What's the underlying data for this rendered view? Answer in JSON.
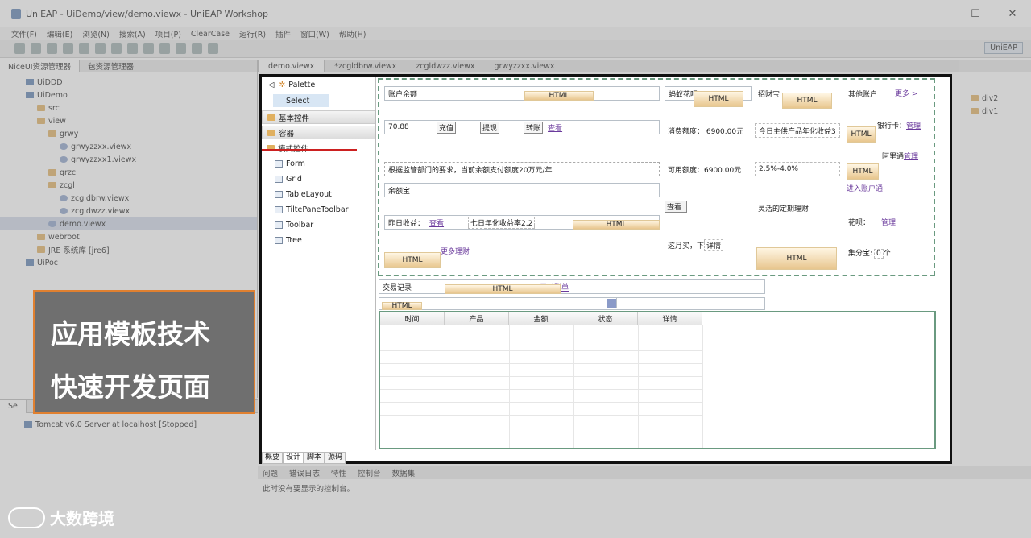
{
  "window": {
    "title": "UniEAP - UiDemo/view/demo.viewx - UniEAP Workshop",
    "controls": [
      "—",
      "☐",
      "✕"
    ]
  },
  "menu": [
    "文件(F)",
    "编辑(E)",
    "浏览(N)",
    "搜索(A)",
    "项目(P)",
    "ClearCase",
    "运行(R)",
    "插件",
    "窗口(W)",
    "帮助(H)"
  ],
  "perspective": {
    "label": "UniEAP"
  },
  "explorer": {
    "tabs": [
      "NiceUI资源管理器",
      "包资源管理器"
    ],
    "tree": [
      {
        "label": "UiDDD",
        "depth": 0,
        "type": "proj"
      },
      {
        "label": "UiDemo",
        "depth": 0,
        "type": "proj"
      },
      {
        "label": "src",
        "depth": 1,
        "type": "folder"
      },
      {
        "label": "view",
        "depth": 1,
        "type": "folder"
      },
      {
        "label": "grwy",
        "depth": 2,
        "type": "folder"
      },
      {
        "label": "grwyzzxx.viewx",
        "depth": 3,
        "type": "file"
      },
      {
        "label": "grwyzzxx1.viewx",
        "depth": 3,
        "type": "file"
      },
      {
        "label": "grzc",
        "depth": 2,
        "type": "folder"
      },
      {
        "label": "zcgl",
        "depth": 2,
        "type": "folder"
      },
      {
        "label": "zcgldbrw.viewx",
        "depth": 3,
        "type": "file"
      },
      {
        "label": "zcgldwzz.viewx",
        "depth": 3,
        "type": "file"
      },
      {
        "label": "demo.viewx",
        "depth": 2,
        "type": "file",
        "selected": true
      },
      {
        "label": "webroot",
        "depth": 1,
        "type": "folder"
      },
      {
        "label": "JRE 系统库 [jre6]",
        "depth": 1,
        "type": "folder"
      },
      {
        "label": "UiPoc",
        "depth": 0,
        "type": "proj"
      }
    ]
  },
  "servers": {
    "tab": "Se",
    "item": "Tomcat v6.0 Server at localhost  [Stopped]"
  },
  "editor": {
    "tabs": [
      "demo.viewx",
      "*zcgldbrw.viewx",
      "zcgldwzz.viewx",
      "grwyzzxx.viewx"
    ]
  },
  "palette": {
    "title": "Palette",
    "select": "Select",
    "categories": [
      "基本控件",
      "容器",
      "模式控件"
    ],
    "items": [
      "Form",
      "Grid",
      "TableLayout",
      "TiltePaneToolbar",
      "Toolbar",
      "Tree"
    ],
    "bottom_tabs": [
      "概要",
      "设计",
      "脚本",
      "源码"
    ]
  },
  "design": {
    "account_balance": "账户余额",
    "html": "HTML",
    "amount": "70.88",
    "btn_recharge": "充值",
    "btn_withdraw": "提现",
    "btn_transfer": "转账",
    "view": "查看",
    "notice": "根据监管部门的要求，当前余额支付额度20万元/年",
    "yuebao": "余额宝",
    "yesterday": "昨日收益：",
    "seven_day": "七日年化收益率2.2",
    "more_wealth": "更多理财",
    "huabei": "蚂蚁花呗",
    "consume_limit": "消费额度：  6900.00元",
    "avail_limit": "可用额度：6900.00元",
    "view_btn": "查看",
    "this_month": "这月买，下",
    "detail": "详情",
    "zhaocai": "招财宝",
    "today_main": "今日主供产品年化收益3",
    "rate": "2.5%-4.0%",
    "flexible": "灵活的定期理财",
    "other_account": "其他账户",
    "more": "更多 >",
    "bankcard": "银行卡：",
    "manage": "管理",
    "ali_comm": "阿里通",
    "enter_account": "进入账户通",
    "huabei2": "花呗：",
    "jifen": "集分宝:",
    "zero": "0",
    "unit": "个",
    "tx_record": "交易记录",
    "e_bill": "电子对账单",
    "table_headers": [
      "时间",
      "产品",
      "金额",
      "状态",
      "详情"
    ]
  },
  "console": {
    "tabs": [
      "问题",
      "错误日志",
      "特性",
      "控制台",
      "数据集"
    ],
    "message": "此时没有要显示的控制台。"
  },
  "outline": {
    "items": [
      "div2",
      "div1"
    ]
  },
  "overlay": {
    "line1": "应用模板技术",
    "line2": "快速开发页面"
  },
  "watermark": {
    "text": "大数跨境"
  }
}
